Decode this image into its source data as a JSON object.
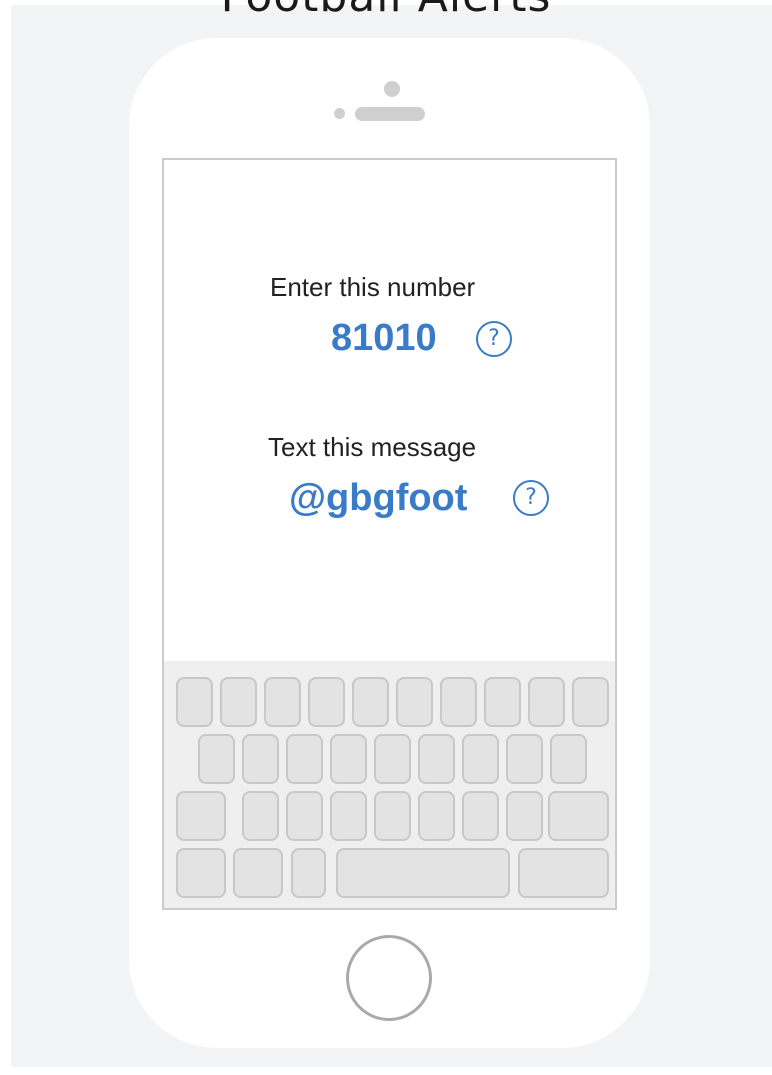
{
  "page": {
    "title": "Football Alerts"
  },
  "instructions": {
    "number_label": "Enter this number",
    "number_value": "81010",
    "message_label": "Text this message",
    "message_value": "@gbgfoot",
    "help_glyph": "?"
  },
  "icons": {
    "help": "question-circle-icon"
  },
  "colors": {
    "accent": "#3a7bc8",
    "panel_background": "#f3f4f5",
    "phone_body": "#ffffff",
    "key_fill": "#e3e3e3",
    "key_border": "#c8c8c8"
  }
}
